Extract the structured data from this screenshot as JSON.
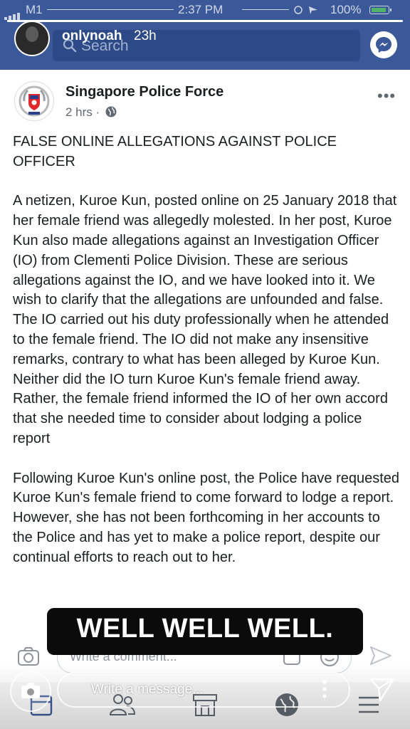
{
  "status_bar": {
    "carrier": "M1",
    "time": "2:37 PM",
    "battery": "100%"
  },
  "story": {
    "username": "onlynoah",
    "age": "23h",
    "progress": 1.0,
    "sticker_text": "WELL WELL WELL.",
    "reply_placeholder": "Write a message..."
  },
  "fb_header": {
    "search_placeholder": "Search",
    "icons": [
      "search-icon",
      "messenger-icon"
    ]
  },
  "post": {
    "page_name": "Singapore Police Force",
    "time": "2 hrs",
    "separator": "·",
    "title": "FALSE ONLINE ALLEGATIONS AGAINST POLICE OFFICER",
    "paragraph_1": "A netizen, Kuroe Kun, posted online on 25 January 2018 that her female friend was allegedly molested. In her post, Kuroe Kun also made allegations against an Investigation Officer (IO) from Clementi Police Division. These are serious allegations against the IO, and we have looked into it. We wish to clarify that the allegations are unfounded and false. The IO carried out his duty professionally when he attended to the female friend. The IO did not make any insensitive remarks, contrary to what has been alleged by Kuroe Kun. Neither did the IO turn Kuroe Kun's female friend away. Rather, the female friend informed the IO of her own accord that she needed time to consider about lodging a police report",
    "paragraph_2": "Following Kuroe Kun's online post, the Police have requested Kuroe Kun's female friend to come forward to lodge a report. However, she has not been forthcoming in her accounts to the Police and has yet to make a police report, despite our continual efforts to reach out to her.",
    "more_label": "•••"
  },
  "comment_bar": {
    "placeholder": "Write a comment..."
  },
  "colors": {
    "fb_blue": "#3b5998",
    "text": "#1c1e21",
    "meta": "#616770"
  }
}
